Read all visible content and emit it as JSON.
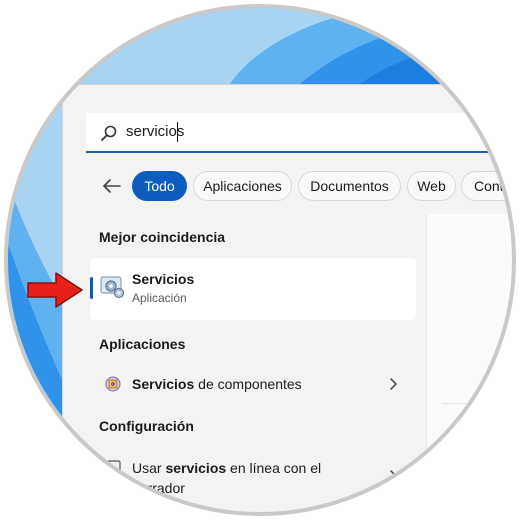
{
  "search": {
    "query": "servicios"
  },
  "filters": {
    "chips": [
      "Todo",
      "Aplicaciones",
      "Documentos",
      "Web",
      "Cont"
    ]
  },
  "sections": {
    "best_match": "Mejor coincidencia",
    "apps": "Aplicaciones",
    "settings": "Configuración"
  },
  "best_match": {
    "title": "Servicios",
    "subtitle": "Aplicación",
    "icon": "services-gear-icon"
  },
  "apps": {
    "item_bold": "Servicios",
    "item_rest": " de componentes",
    "icon": "component-services-icon"
  },
  "settings": {
    "item_prefix": "Usar ",
    "item_bold": "servicios",
    "item_suffix": " en línea con el",
    "item_line2": "narrador",
    "icon": "settings-icon"
  },
  "colors": {
    "accent": "#0f5cbf",
    "pointer_arrow": "#e8201c",
    "wallpaper": "#2a8ee8"
  }
}
